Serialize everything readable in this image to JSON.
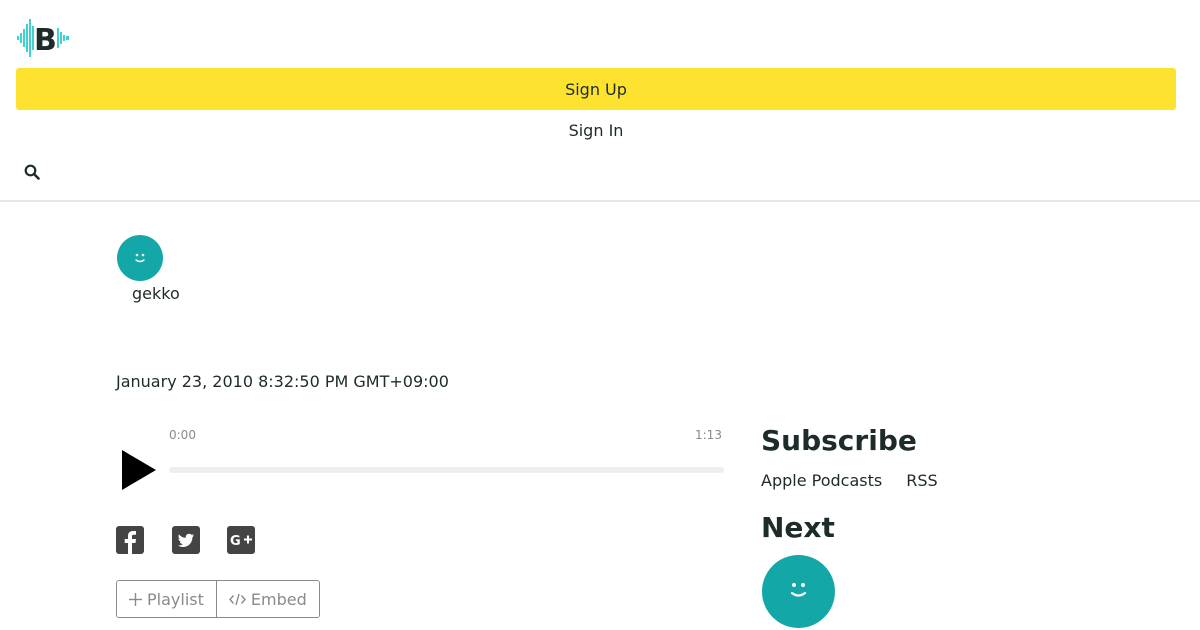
{
  "header": {
    "logo_icon": "logo-waveform-b-icon",
    "signup_label": "Sign Up",
    "signin_label": "Sign In",
    "search_icon": "search-icon"
  },
  "episode": {
    "user_name": "gekko",
    "date": "January 23, 2010 8:32:50 PM GMT+09:00"
  },
  "player": {
    "current_time": "0:00",
    "duration": "1:13",
    "progress": 0
  },
  "share": {
    "icons": [
      "facebook-icon",
      "twitter-icon",
      "google-plus-icon"
    ]
  },
  "actions": {
    "playlist_label": "Playlist",
    "embed_label": "Embed"
  },
  "sidebar": {
    "subscribe_title": "Subscribe",
    "apple_podcasts_label": "Apple Podcasts",
    "rss_label": "RSS",
    "next_title": "Next"
  },
  "colors": {
    "accent_yellow": "#fde330",
    "teal": "#14a7a7",
    "text": "#1d2b2b",
    "muted": "#8a8a8a"
  }
}
